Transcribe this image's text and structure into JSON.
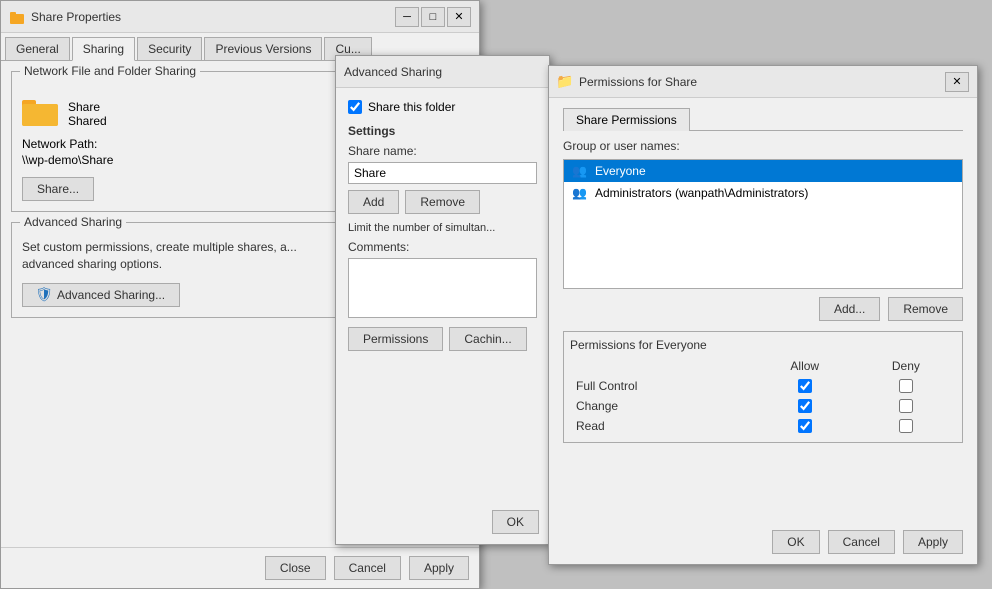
{
  "shareProps": {
    "title": "Share Properties",
    "tabs": [
      {
        "id": "general",
        "label": "General"
      },
      {
        "id": "sharing",
        "label": "Sharing",
        "active": true
      },
      {
        "id": "security",
        "label": "Security"
      },
      {
        "id": "previousVersions",
        "label": "Previous Versions"
      },
      {
        "id": "customize",
        "label": "Cu..."
      }
    ],
    "networkSharing": {
      "groupTitle": "Network File and Folder Sharing",
      "shareName": "Share",
      "shareStatus": "Shared"
    },
    "networkPath": {
      "label": "Network Path:",
      "value": "\\\\wp-demo\\Share"
    },
    "shareButton": "Share...",
    "advancedSharing": {
      "groupTitle": "Advanced Sharing",
      "description": "Set custom permissions, create multiple shares, a...\nadvanced sharing options.",
      "button": "Advanced Sharing..."
    },
    "buttons": {
      "close": "Close",
      "cancel": "Cancel",
      "apply": "Apply"
    }
  },
  "advancedSharing": {
    "title": "Advanced Sharing",
    "checkbox": {
      "label": "Share this folder",
      "checked": true
    },
    "settings": "Settings",
    "shareName": {
      "label": "Share name:",
      "value": "Share"
    },
    "buttons": {
      "add": "Add",
      "remove": "Remove"
    },
    "limitLabel": "Limit the number of simultan...",
    "comments": {
      "label": "Comments:",
      "value": ""
    },
    "permissionsButton": "Permissions",
    "cachingButton": "Cachin...",
    "ok": "OK"
  },
  "permissionsWindow": {
    "title": "Permissions for Share",
    "tabLabel": "Share Permissions",
    "groupLabel": "Group or user names:",
    "users": [
      {
        "name": "Everyone",
        "selected": true,
        "icon": "people"
      },
      {
        "name": "Administrators (wanpath\\Administrators)",
        "selected": false,
        "icon": "people"
      }
    ],
    "buttons": {
      "add": "Add...",
      "remove": "Remove"
    },
    "permissionsLabel": "Permissions for Everyone",
    "columns": {
      "permission": "",
      "allow": "Allow",
      "deny": "Deny"
    },
    "permissions": [
      {
        "name": "Full Control",
        "allow": true,
        "deny": false
      },
      {
        "name": "Change",
        "allow": true,
        "deny": false
      },
      {
        "name": "Read",
        "allow": true,
        "deny": false
      }
    ],
    "bottomButtons": {
      "ok": "OK",
      "cancel": "Cancel",
      "apply": "Apply"
    }
  },
  "icons": {
    "folder": "📁",
    "shield": "🛡",
    "people": "👥",
    "close": "✕",
    "check": "✓"
  }
}
